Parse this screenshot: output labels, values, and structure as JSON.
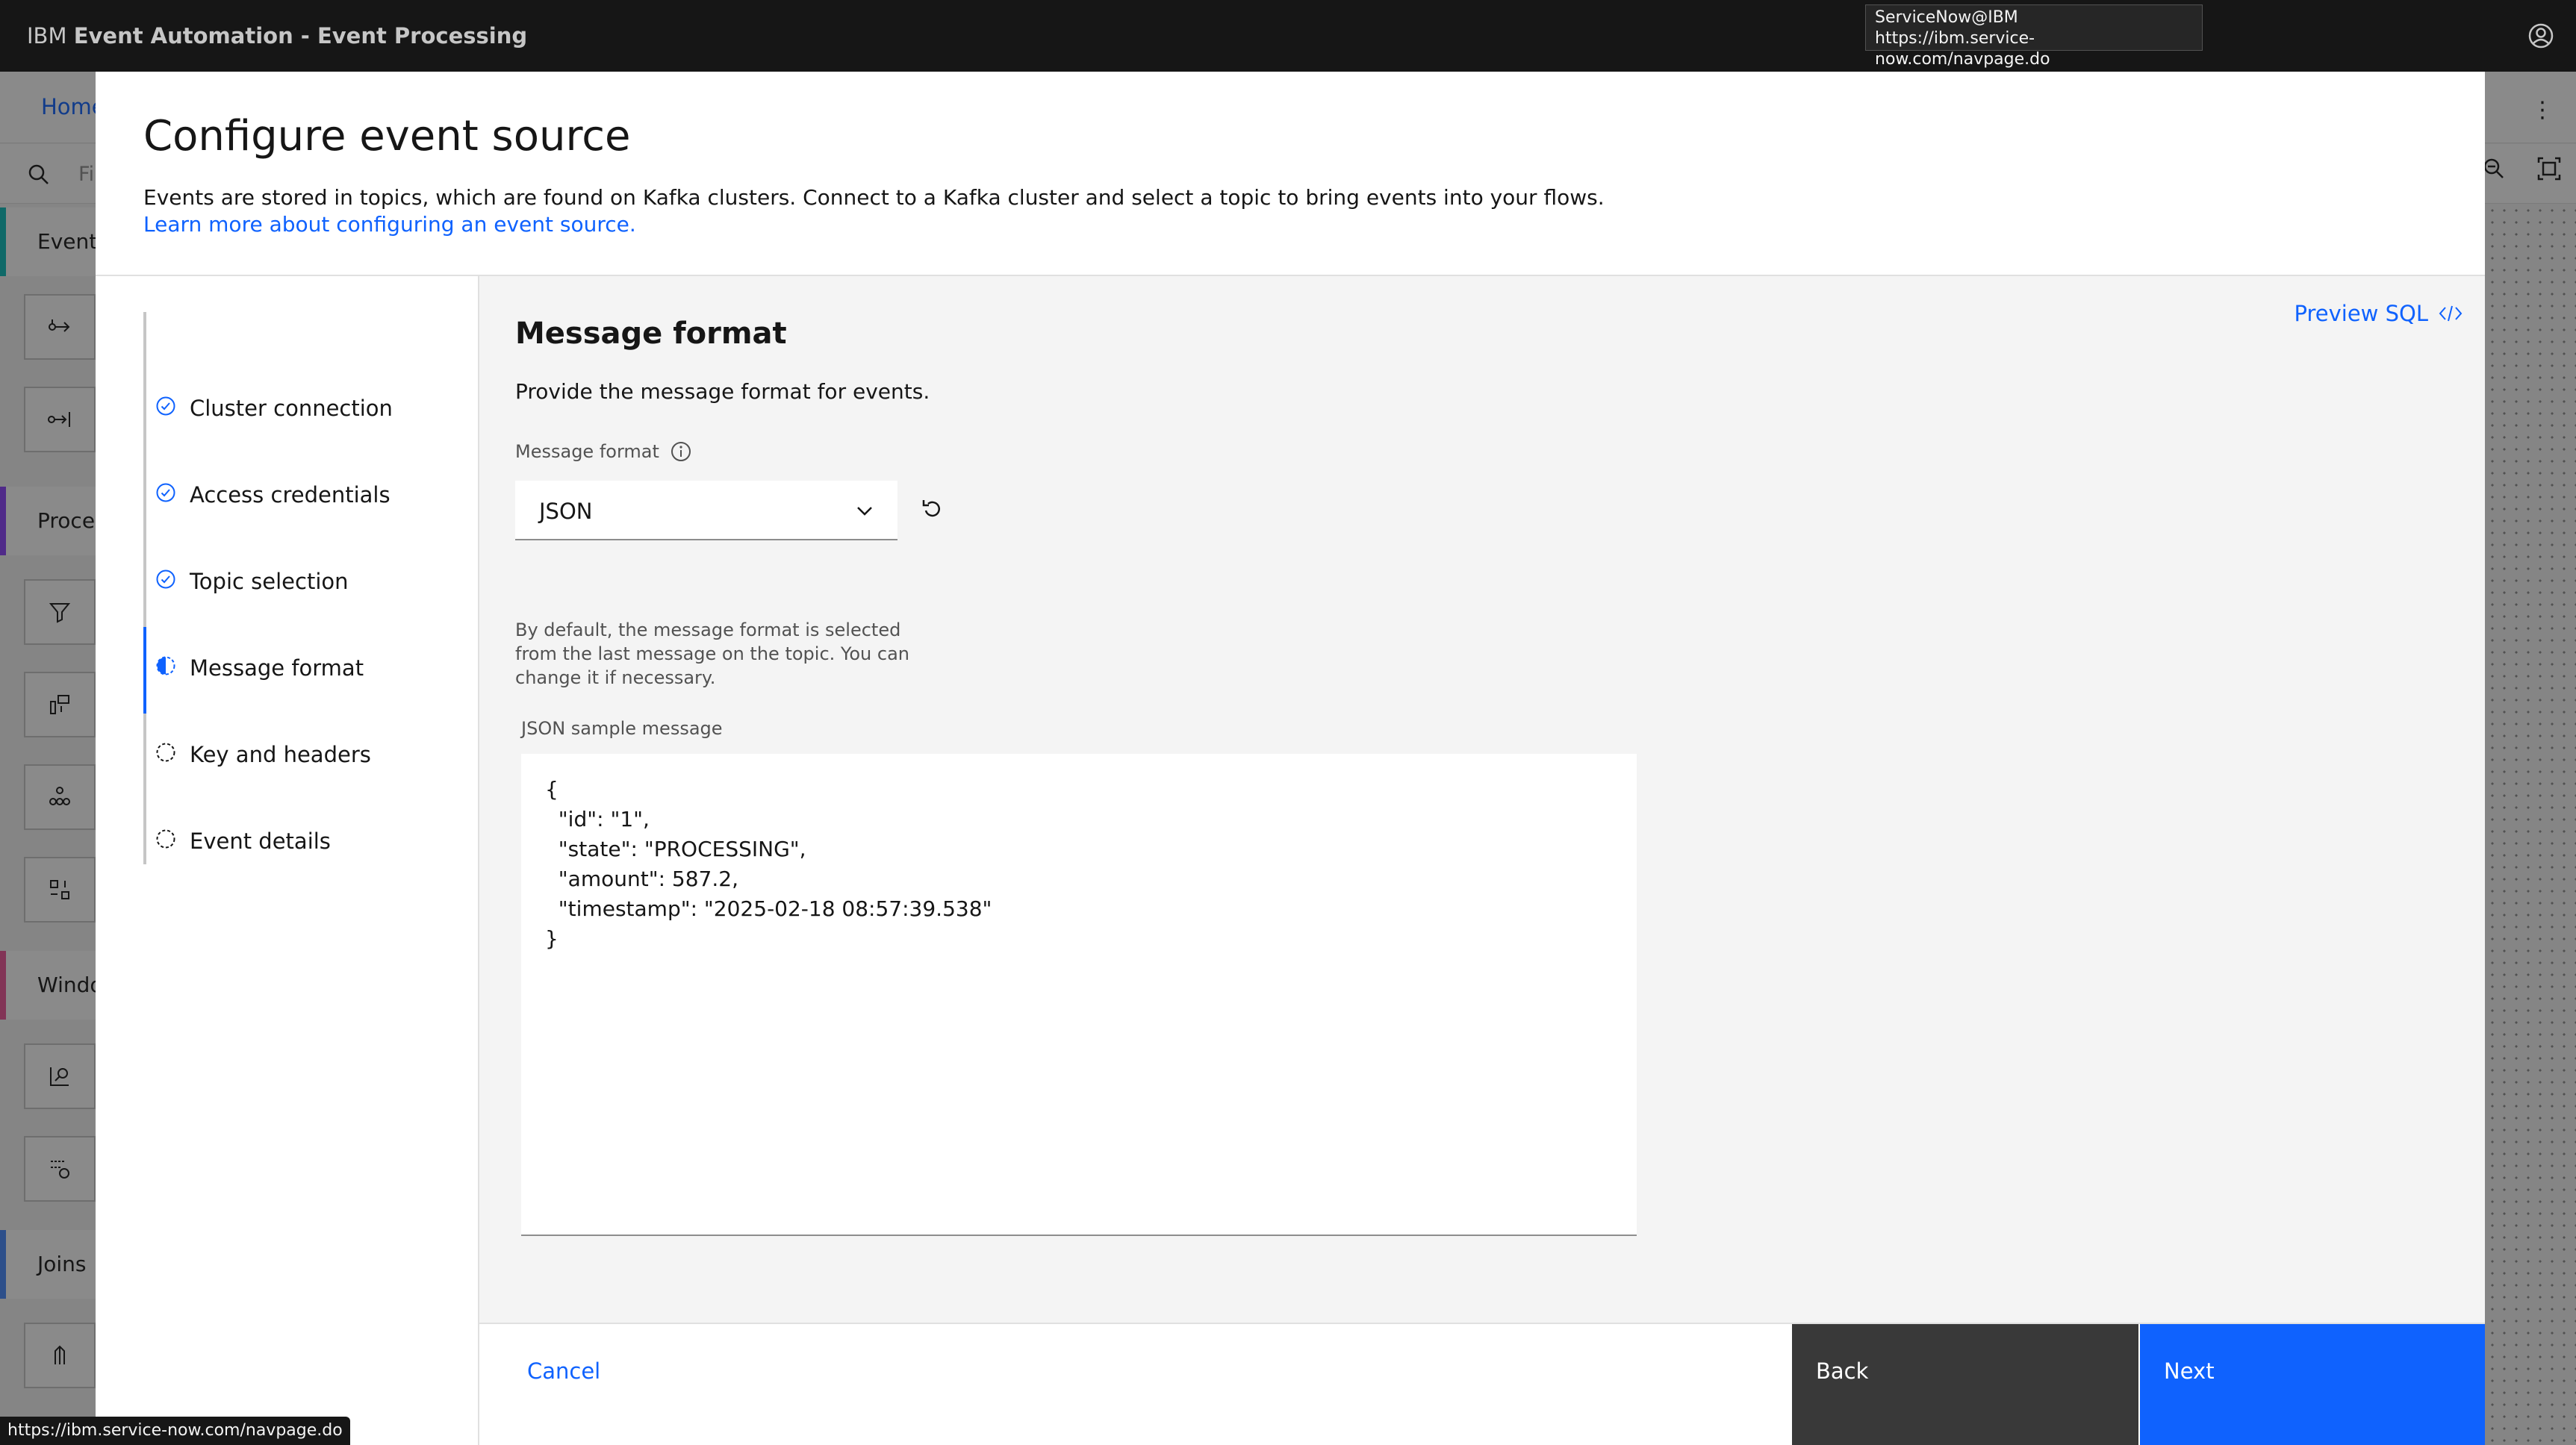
{
  "app": {
    "brand_prefix": "IBM",
    "brand_name": "Event Automation - Event Processing"
  },
  "tooltip": {
    "line1": "ServiceNow@IBM",
    "line2": "https://ibm.service-now.com/navpage.do"
  },
  "background": {
    "home_tab": "Home",
    "search_placeholder": "Fi",
    "categories": [
      "Events",
      "Proces",
      "Windo",
      "Joins"
    ],
    "category_colors": [
      "#08bdba",
      "#8a3ffc",
      "#ee5396",
      "#4589ff"
    ]
  },
  "modal": {
    "title": "Configure event source",
    "description": "Events are stored in topics, which are found on Kafka clusters. Connect to a Kafka cluster and select a topic to bring events into your flows.",
    "learn_more": "Learn more about configuring an event source."
  },
  "steps": [
    {
      "label": "Cluster connection",
      "status": "complete"
    },
    {
      "label": "Access credentials",
      "status": "complete"
    },
    {
      "label": "Topic selection",
      "status": "complete"
    },
    {
      "label": "Message format",
      "status": "current"
    },
    {
      "label": "Key and headers",
      "status": "incomplete"
    },
    {
      "label": "Event details",
      "status": "incomplete"
    }
  ],
  "content": {
    "preview_sql": "Preview SQL",
    "section_title": "Message format",
    "section_desc": "Provide the message format for events.",
    "format_label": "Message format",
    "format_value": "JSON",
    "helper_text": "By default, the message format is selected from the last message on the topic. You can change it if necessary.",
    "sample_label": "JSON sample message",
    "sample_message": "{\n  \"id\": \"1\",\n  \"state\": \"PROCESSING\",\n  \"amount\": 587.2,\n  \"timestamp\": \"2025-02-18 08:57:39.538\"\n}"
  },
  "footer": {
    "cancel": "Cancel",
    "back": "Back",
    "next": "Next"
  },
  "status_bar": {
    "url": "https://ibm.service-now.com/navpage.do"
  },
  "colors": {
    "accent": "#0f62fe",
    "header_bg": "#161616",
    "back_button": "#393939"
  }
}
